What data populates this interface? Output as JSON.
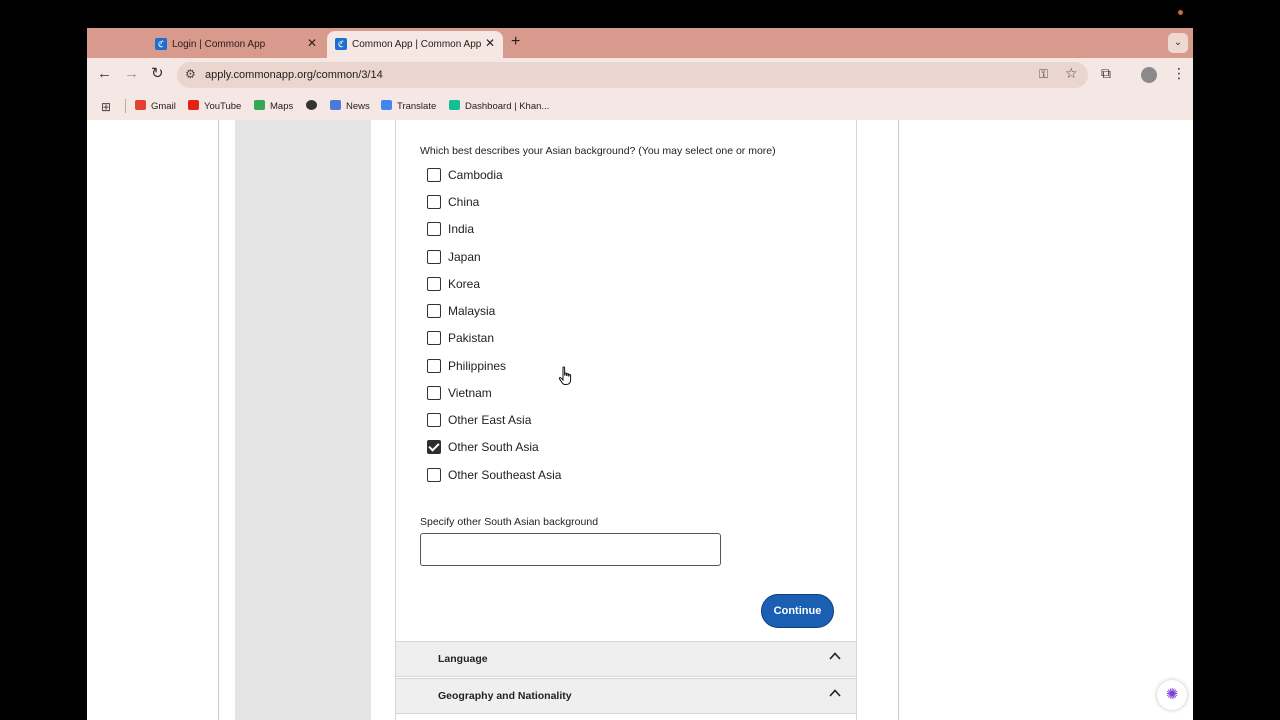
{
  "browser": {
    "tabs": [
      {
        "title": "Login | Common App",
        "close": "✕"
      },
      {
        "title": "Common App | Common App",
        "close": "✕"
      }
    ],
    "new_tab": "+",
    "url": "apply.commonapp.org/common/3/14",
    "bookmarks": [
      "Gmail",
      "YouTube",
      "Maps",
      "News",
      "Translate",
      "Dashboard | Khan..."
    ]
  },
  "form": {
    "question": "Which best describes your Asian background? (You may select one or more)",
    "options": [
      {
        "label": "Cambodia",
        "checked": false
      },
      {
        "label": "China",
        "checked": false
      },
      {
        "label": "India",
        "checked": false
      },
      {
        "label": "Japan",
        "checked": false
      },
      {
        "label": "Korea",
        "checked": false
      },
      {
        "label": "Malaysia",
        "checked": false
      },
      {
        "label": "Pakistan",
        "checked": false
      },
      {
        "label": "Philippines",
        "checked": false
      },
      {
        "label": "Vietnam",
        "checked": false
      },
      {
        "label": "Other East Asia",
        "checked": false
      },
      {
        "label": "Other South Asia",
        "checked": true
      },
      {
        "label": "Other Southeast Asia",
        "checked": false
      }
    ],
    "specify_label": "Specify other South Asian background",
    "specify_value": "",
    "continue_label": "Continue"
  },
  "sections": [
    {
      "title": "Language"
    },
    {
      "title": "Geography and Nationality"
    }
  ],
  "colors": {
    "accent": "#1a5fb4",
    "tab_strip": "#d89a8d",
    "toolbar": "#f5e7e3"
  }
}
